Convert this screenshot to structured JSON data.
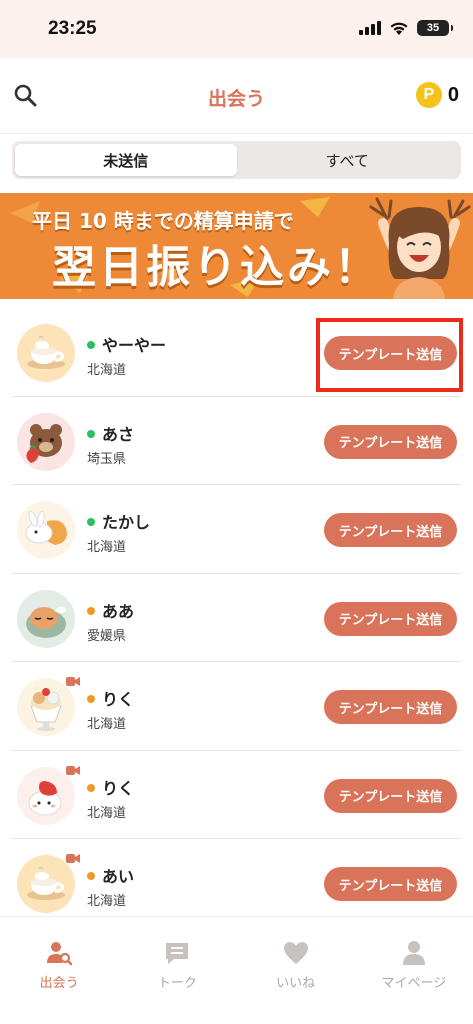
{
  "status_bar": {
    "time": "23:25",
    "battery": "35"
  },
  "header": {
    "title": "出会う",
    "coin_symbol": "P",
    "points": "0"
  },
  "tabs": [
    {
      "label": "未送信",
      "active": true
    },
    {
      "label": "すべて",
      "active": false
    }
  ],
  "banner": {
    "line1": "平日 10 時までの精算申請で",
    "line2": "翌日振り込み！"
  },
  "template_button_label": "テンプレート送信",
  "users": [
    {
      "name": "やーやー",
      "prefecture": "北海道",
      "status": "online",
      "video": false,
      "avatar": "coffee-cup"
    },
    {
      "name": "あさ",
      "prefecture": "埼玉県",
      "status": "online",
      "video": false,
      "avatar": "bear-strawberry"
    },
    {
      "name": "たかし",
      "prefecture": "北海道",
      "status": "online",
      "video": false,
      "avatar": "rabbit-bread"
    },
    {
      "name": "ああ",
      "prefecture": "愛媛県",
      "status": "away",
      "video": false,
      "avatar": "sleeping-animal"
    },
    {
      "name": "りく",
      "prefecture": "北海道",
      "status": "away",
      "video": true,
      "avatar": "parfait-cat"
    },
    {
      "name": "りく",
      "prefecture": "北海道",
      "status": "away",
      "video": true,
      "avatar": "mochi-strawberry"
    },
    {
      "name": "あい",
      "prefecture": "北海道",
      "status": "away",
      "video": true,
      "avatar": "coffee-cup"
    }
  ],
  "nav": [
    {
      "label": "出会う",
      "icon": "person-search-icon",
      "active": true
    },
    {
      "label": "トーク",
      "icon": "chat-icon",
      "active": false
    },
    {
      "label": "いいね",
      "icon": "heart-icon",
      "active": false
    },
    {
      "label": "マイページ",
      "icon": "person-icon",
      "active": false
    }
  ],
  "colors": {
    "accent": "#d9745a",
    "online": "#2bbf5e",
    "away": "#f29a25",
    "banner": "#ee8a37",
    "highlight": "#ee2a1a"
  }
}
